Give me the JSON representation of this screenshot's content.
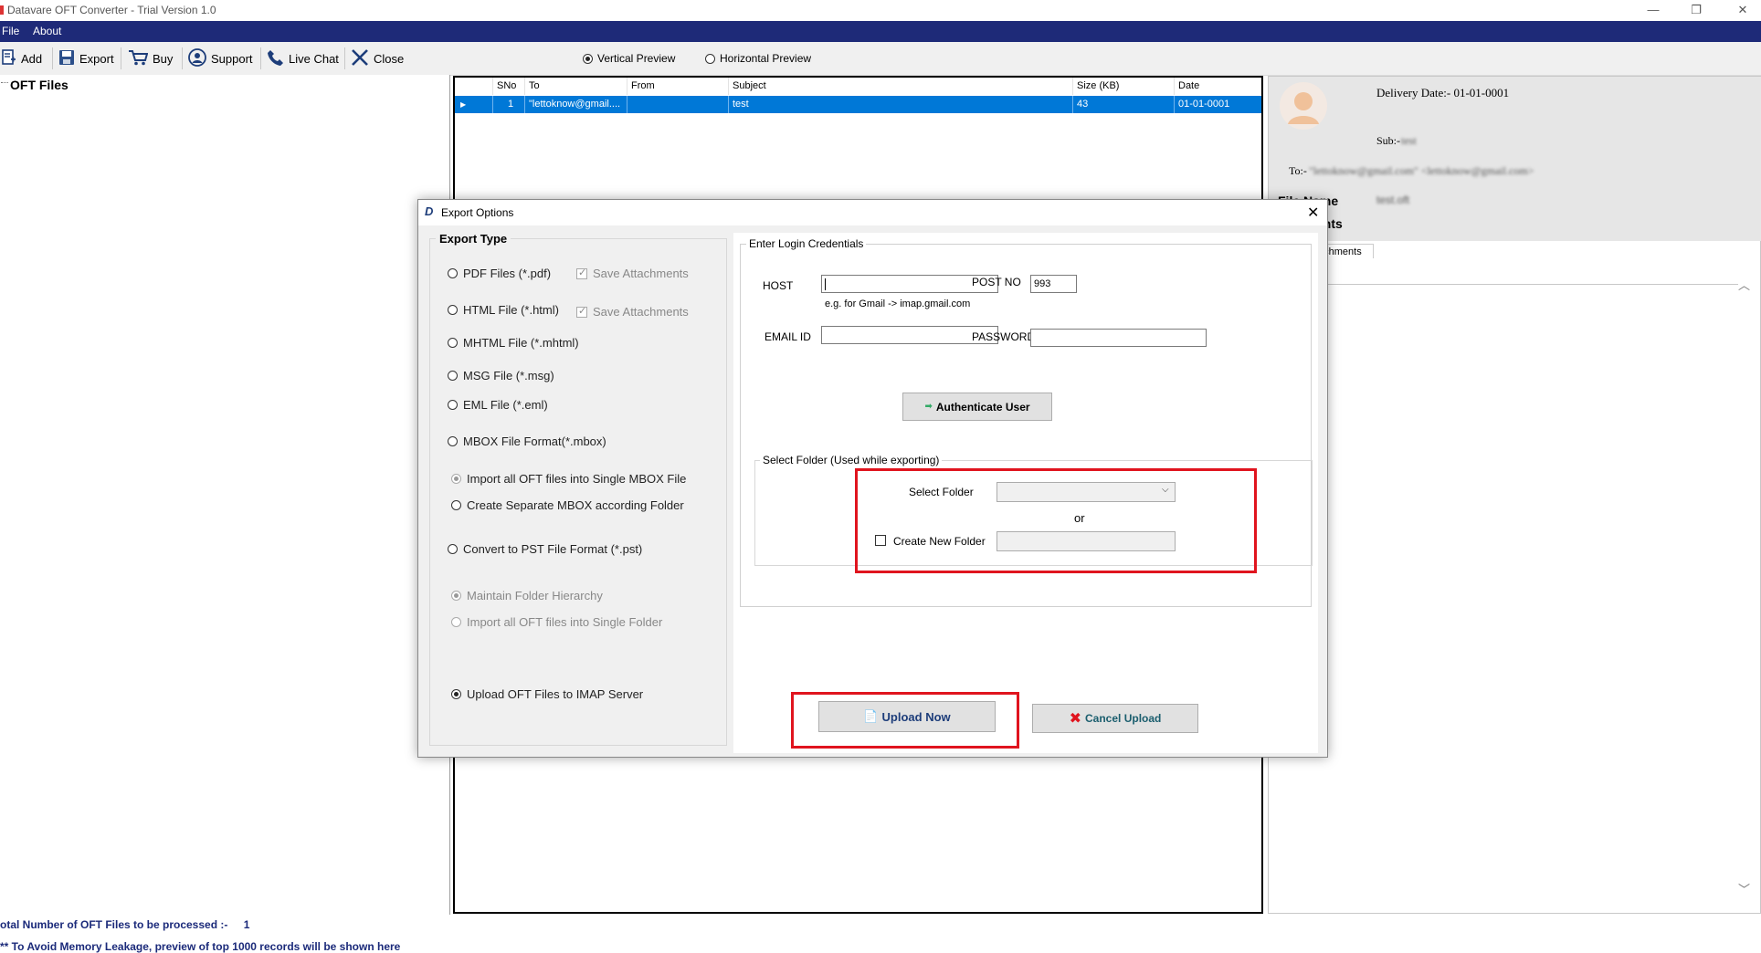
{
  "window": {
    "title": "Datavare OFT Converter - Trial Version 1.0",
    "minimize": "—",
    "restore": "❐",
    "close": "✕"
  },
  "menu": {
    "file": "File",
    "about": "About"
  },
  "toolbar": {
    "add": "Add",
    "export": "Export",
    "buy": "Buy",
    "support": "Support",
    "live_chat": "Live Chat",
    "close": "Close",
    "vertical_preview": "Vertical Preview",
    "horizontal_preview": "Horizontal Preview",
    "selected_preview": "vertical"
  },
  "tree": {
    "root": "OFT Files"
  },
  "grid": {
    "columns": [
      "SNo",
      "To",
      "From",
      "Subject",
      "Size (KB)",
      "Date"
    ],
    "rows": [
      {
        "sno": "1",
        "to": "\"lettoknow@gmail....",
        "from": "",
        "subject": "test",
        "size": "43",
        "date": "01-01-0001"
      }
    ],
    "selected_color": "#0078d7"
  },
  "preview": {
    "delivery_date": "Delivery Date:- 01-01-0001",
    "sub_label": "Sub:-",
    "sub_value": "test",
    "to_label": "To:-",
    "to_value": "\"lettoknow@gmail.com\" <lettoknow@gmail.com>",
    "file_name_label": "File Name",
    "file_name_value": "test.oft",
    "attachments_label": "ents",
    "tab_label": "achments",
    "scroll_up": "︿",
    "scroll_down": "﹀"
  },
  "dialog": {
    "title": "Export Options",
    "close": "✕",
    "export_type_title": "Export Type",
    "options": {
      "pdf": "PDF Files (*.pdf)",
      "html": "HTML File  (*.html)",
      "mhtml": "MHTML File  (*.mhtml)",
      "msg": "MSG File (*.msg)",
      "eml": "EML File (*.eml)",
      "mbox": "MBOX File Format(*.mbox)",
      "mbox_single": "Import all OFT files into Single MBOX File",
      "mbox_separate": "Create Separate MBOX according Folder",
      "pst": "Convert to PST File Format (*.pst)",
      "pst_hierarchy": "Maintain Folder Hierarchy",
      "pst_single": "Import all OFT files into Single Folder",
      "imap": "Upload OFT Files to IMAP Server",
      "save_attachments": "Save Attachments"
    },
    "selected_option": "imap",
    "credentials": {
      "title": "Enter Login Credentials",
      "host_label": "HOST",
      "host_value": "",
      "host_hint": "e.g. for Gmail -> imap.gmail.com",
      "port_label": "POST NO",
      "port_value": "993",
      "email_label": "EMAIL ID",
      "email_value": "",
      "password_label": "PASSWORD",
      "password_value": "",
      "authenticate": "Authenticate User"
    },
    "folder": {
      "title": "Select Folder (Used while exporting)",
      "select_label": "Select Folder",
      "select_value": "",
      "or": "or",
      "create_label": "Create New Folder",
      "create_value": ""
    },
    "upload_now": "Upload Now",
    "cancel_upload": "Cancel Upload"
  },
  "status": {
    "total_label": "otal Number of OFT Files to be processed :-",
    "total_value": "1",
    "notice": "** To Avoid Memory Leakage, preview of top 1000 records will be shown here"
  },
  "colors": {
    "menubar": "#1e2a78",
    "highlight_red": "#e0141e",
    "selection_blue": "#0078d7",
    "status_text": "#1b2a7a"
  }
}
